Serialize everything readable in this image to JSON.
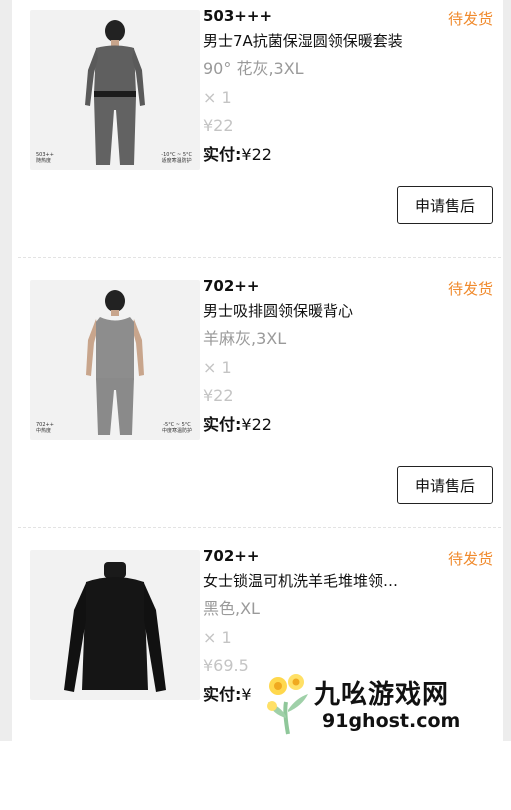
{
  "orders": [
    {
      "code": "503+++",
      "status": "待发货",
      "title": "男士7A抗菌保湿圆领保暖套装",
      "variant": "90° 花灰,3XL",
      "quantity": "× 1",
      "price": "¥22",
      "paid_label": "实付:",
      "paid_value": "¥22",
      "after_sale_button": "申请售后",
      "image_caption_left": [
        "503++",
        "随热度"
      ],
      "image_caption_right": [
        "-10°C ~ 5°C",
        "适度寒温防护"
      ]
    },
    {
      "code": "702++",
      "status": "待发货",
      "title": "男士吸排圆领保暖背心",
      "variant": "羊麻灰,3XL",
      "quantity": "× 1",
      "price": "¥22",
      "paid_label": "实付:",
      "paid_value": "¥22",
      "after_sale_button": "申请售后",
      "image_caption_left": [
        "702++",
        "中热度"
      ],
      "image_caption_right": [
        "-5°C ~ 5°C",
        "中度寒温防护"
      ]
    },
    {
      "code": "702++",
      "status": "待发货",
      "title": "女士锁温可机洗羊毛堆堆领…",
      "variant": "黑色,XL",
      "quantity": "× 1",
      "price": "¥69.5",
      "paid_label": "实付:",
      "paid_value": "¥"
    }
  ],
  "watermark": {
    "name": "九吆游戏网",
    "url": "91ghost.com"
  },
  "colors": {
    "status": "#f08a2c",
    "muted": "#9a9a9a",
    "faint": "#c4c4c4",
    "background_strip": "#ededed"
  }
}
